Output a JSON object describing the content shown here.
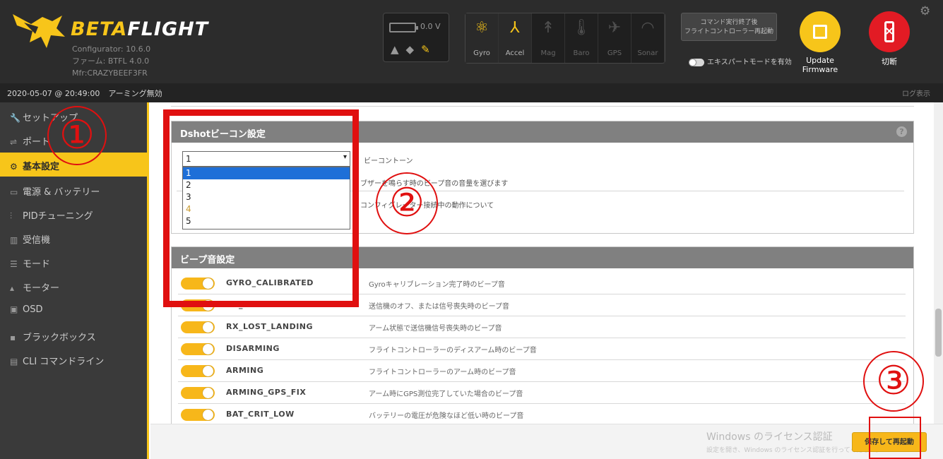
{
  "header": {
    "brand_part1": "BETA",
    "brand_part2": "FLIGHT",
    "version_lines": [
      "Configurator: 10.6.0",
      "ファーム: BTFL 4.0.0",
      "Mfr:CRAZYBEEF3FR"
    ],
    "voltage": "0.0 V",
    "sensors": [
      {
        "label": "Gyro",
        "icon": "gyro-icon",
        "active": true
      },
      {
        "label": "Accel",
        "icon": "accel-icon",
        "active": true
      },
      {
        "label": "Mag",
        "icon": "mag-icon",
        "active": false
      },
      {
        "label": "Baro",
        "icon": "baro-icon",
        "active": false
      },
      {
        "label": "GPS",
        "icon": "gps-icon",
        "active": false
      },
      {
        "label": "Sonar",
        "icon": "sonar-icon",
        "active": false
      }
    ],
    "expert_button_lines": [
      "コマンド実行終了後",
      "フライトコントローラー再起動"
    ],
    "expert_mode_label": "エキスパートモードを有効",
    "update_firmware": [
      "Update",
      "Firmware"
    ],
    "connect_label": "切断",
    "accent_color": "#f7c51a"
  },
  "logbar": {
    "timestamp": "2020-05-07 @ 20:49:00",
    "event": "アーミング無効",
    "hide_label": "ログ表示"
  },
  "sidebar": {
    "items": [
      {
        "label": "セットアップ",
        "icon": "wrench-icon",
        "active": false
      },
      {
        "label": "ポート",
        "icon": "plug-icon",
        "active": false
      },
      {
        "label": "基本設定",
        "icon": "gear-icon",
        "active": true
      },
      {
        "label": "電源 & バッテリー",
        "icon": "battery-icon",
        "active": false
      },
      {
        "label": "PIDチューニング",
        "icon": "pid-icon",
        "active": false
      },
      {
        "label": "受信機",
        "icon": "receiver-icon",
        "active": false
      },
      {
        "label": "モード",
        "icon": "modes-icon",
        "active": false
      },
      {
        "label": "モーター",
        "icon": "motor-icon",
        "active": false
      },
      {
        "label": "OSD",
        "icon": "osd-icon",
        "active": false
      },
      {
        "label": "ブラックボックス",
        "icon": "blackbox-icon",
        "active": false
      },
      {
        "label": "CLI コマンドライン",
        "icon": "cli-icon",
        "active": false
      }
    ]
  },
  "dshot": {
    "title": "Dshotビーコン設定",
    "selected": "1",
    "options": [
      "1",
      "2",
      "3",
      "4",
      "5"
    ],
    "tone_label": "ビーコントーン",
    "desc1": "ブザーを鳴らす時のビープ音の音量を選びます",
    "desc2": "コンフィグレーター接続中の動作について"
  },
  "beeper": {
    "title": "ビープ音設定",
    "rows": [
      {
        "name": "GYRO_CALIBRATED",
        "desc": "Gyroキャリブレーション完了時のビープ音"
      },
      {
        "name": "RX_LOST",
        "desc": "送信機のオフ、または信号喪失時のビープ音"
      },
      {
        "name": "RX_LOST_LANDING",
        "desc": "アーム状態で送信機信号喪失時のビープ音"
      },
      {
        "name": "DISARMING",
        "desc": "フライトコントローラーのディスアーム時のビープ音"
      },
      {
        "name": "ARMING",
        "desc": "フライトコントローラーのアーム時のビープ音"
      },
      {
        "name": "ARMING_GPS_FIX",
        "desc": "アーム時にGPS測位完了していた場合のビープ音"
      },
      {
        "name": "BAT_CRIT_LOW",
        "desc": "バッテリーの電圧が危険なほど低い時のビープ音"
      }
    ]
  },
  "footer": {
    "watermark": "Windows のライセンス認証",
    "watermark_sub": "設定を開き、Windows のライセンス認証を行ってください。",
    "save_button": "保存して再起動"
  },
  "annotations": [
    "①",
    "②",
    "③"
  ]
}
